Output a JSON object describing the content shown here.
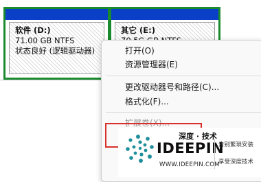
{
  "volumes": {
    "d": {
      "title": "软件 (D:)",
      "size": "71.00 GB NTFS",
      "status": "状态良好 (逻辑驱动器)"
    },
    "e": {
      "title": "其它 (E:)",
      "size": "70.5G GB NTFS"
    }
  },
  "context_menu": {
    "open": "打开(O)",
    "explorer": "资源管理器(E)",
    "change_letter": "更改驱动器号和路径(C)...",
    "format": "格式化(F)...",
    "extend": "扩展卷(X)..."
  },
  "watermark": {
    "title_cn": "深度 · 技术",
    "brand": "IDEEPIN",
    "url": "WWW.IDEEPIN.COM",
    "tagline1": "告别繁琐安装",
    "tagline2": "享受深度技术"
  },
  "colors": {
    "partition_header": "#0a3fc8",
    "partition_border": "#198a2d",
    "highlight": "#d8312b",
    "logo_teal": "#1f8f9c"
  }
}
